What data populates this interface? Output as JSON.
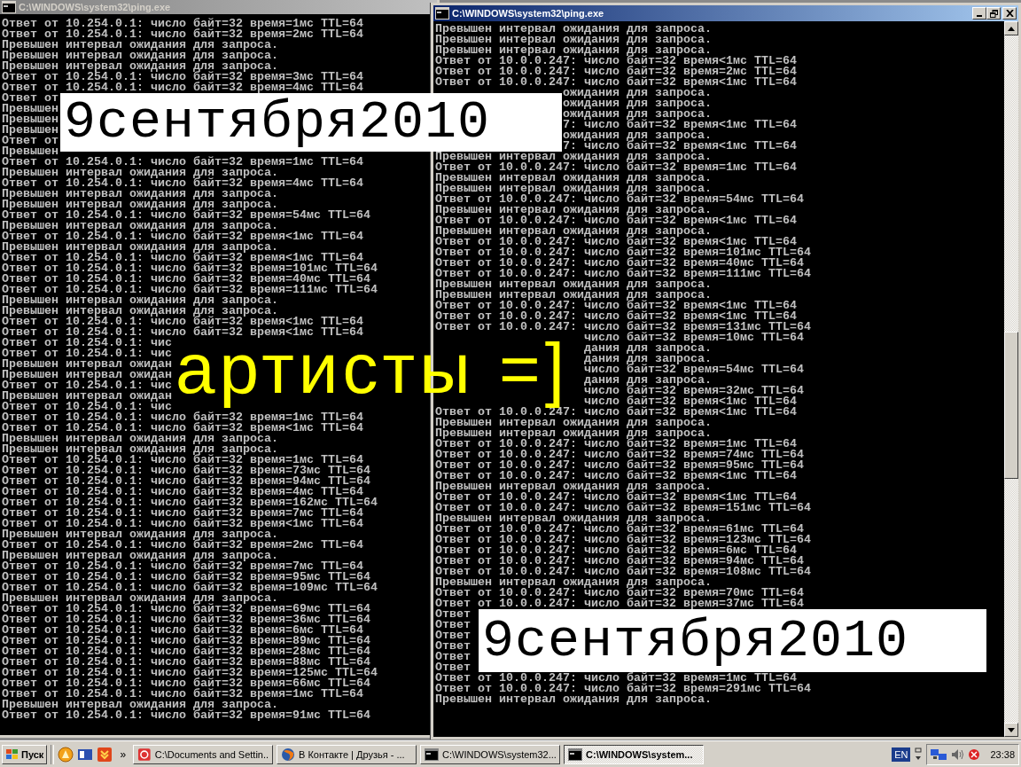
{
  "back_window": {
    "title": "C:\\WINDOWS\\system32\\ping.exe",
    "active": false,
    "lines": [
      "Ответ от 10.254.0.1: число байт=32 время=1мс TTL=64",
      "Ответ от 10.254.0.1: число байт=32 время=2мс TTL=64",
      "Превышен интервал ожидания для запроса.",
      "Превышен интервал ожидания для запроса.",
      "Превышен интервал ожидания для запроса.",
      "Ответ от 10.254.0.1: число байт=32 время=3мс TTL=64",
      "Ответ от 10.254.0.1: число байт=32 время=4мс TTL=64",
      "Ответ от",
      "Превышен",
      "Превышен",
      "Превышен",
      "Ответ от",
      "Превышен",
      "Ответ от 10.254.0.1: число байт=32 время=1мс TTL=64",
      "Превышен интервал ожидания для запроса.",
      "Ответ от 10.254.0.1: число байт=32 время=4мс TTL=64",
      "Превышен интервал ожидания для запроса.",
      "Превышен интервал ожидания для запроса.",
      "Ответ от 10.254.0.1: число байт=32 время=54мс TTL=64",
      "Превышен интервал ожидания для запроса.",
      "Ответ от 10.254.0.1: число байт=32 время<1мс TTL=64",
      "Превышен интервал ожидания для запроса.",
      "Ответ от 10.254.0.1: число байт=32 время<1мс TTL=64",
      "Ответ от 10.254.0.1: число байт=32 время=101мс TTL=64",
      "Ответ от 10.254.0.1: число байт=32 время=40мс TTL=64",
      "Ответ от 10.254.0.1: число байт=32 время=111мс TTL=64",
      "Превышен интервал ожидания для запроса.",
      "Превышен интервал ожидания для запроса.",
      "Ответ от 10.254.0.1: число байт=32 время<1мс TTL=64",
      "Ответ от 10.254.0.1: число байт=32 время<1мс TTL=64",
      "Ответ от 10.254.0.1: чис",
      "Ответ от 10.254.0.1: чис",
      "Превышен интервал ожидан",
      "Превышен интервал ожидан",
      "Ответ от 10.254.0.1: чис",
      "Превышен интервал ожидан",
      "Ответ от 10.254.0.1: чис",
      "Ответ от 10.254.0.1: число байт=32 время=1мс TTL=64",
      "Ответ от 10.254.0.1: число байт=32 время<1мс TTL=64",
      "Превышен интервал ожидания для запроса.",
      "Превышен интервал ожидания для запроса.",
      "Ответ от 10.254.0.1: число байт=32 время=1мс TTL=64",
      "Ответ от 10.254.0.1: число байт=32 время=73мс TTL=64",
      "Ответ от 10.254.0.1: число байт=32 время=94мс TTL=64",
      "Ответ от 10.254.0.1: число байт=32 время=4мс TTL=64",
      "Ответ от 10.254.0.1: число байт=32 время=162мс TTL=64",
      "Ответ от 10.254.0.1: число байт=32 время=7мс TTL=64",
      "Ответ от 10.254.0.1: число байт=32 время<1мс TTL=64",
      "Превышен интервал ожидания для запроса.",
      "Ответ от 10.254.0.1: число байт=32 время=2мс TTL=64",
      "Превышен интервал ожидания для запроса.",
      "Ответ от 10.254.0.1: число байт=32 время=7мс TTL=64",
      "Ответ от 10.254.0.1: число байт=32 время=95мс TTL=64",
      "Ответ от 10.254.0.1: число байт=32 время=109мс TTL=64",
      "Превышен интервал ожидания для запроса.",
      "Ответ от 10.254.0.1: число байт=32 время=69мс TTL=64",
      "Ответ от 10.254.0.1: число байт=32 время=36мс TTL=64",
      "Ответ от 10.254.0.1: число байт=32 время=6мс TTL=64",
      "Ответ от 10.254.0.1: число байт=32 время=89мс TTL=64",
      "Ответ от 10.254.0.1: число байт=32 время=28мс TTL=64",
      "Ответ от 10.254.0.1: число байт=32 время=88мс TTL=64",
      "Ответ от 10.254.0.1: число байт=32 время=125мс TTL=64",
      "Ответ от 10.254.0.1: число байт=32 время=66мс TTL=64",
      "Ответ от 10.254.0.1: число байт=32 время=1мс TTL=64",
      "Превышен интервал ожидания для запроса.",
      "Ответ от 10.254.0.1: число байт=32 время=91мс TTL=64"
    ]
  },
  "front_window": {
    "title": "C:\\WINDOWS\\system32\\ping.exe",
    "active": true,
    "lines": [
      {
        "text": "Превышен интервал ожидания для запроса.",
        "under_label": false,
        "under_caption": false
      },
      {
        "text": "Превышен интервал ожидания для запроса.",
        "under_label": false,
        "under_caption": false
      },
      {
        "text": "Превышен интервал ожидания для запроса.",
        "under_label": false,
        "under_caption": false
      },
      {
        "text": "Ответ от 10.0.0.247: число байт=32 время<1мс TTL=64",
        "under_label": false,
        "under_caption": false
      },
      {
        "text": "Ответ от 10.0.0.247: число байт=32 время=2мс TTL=64",
        "under_label": false,
        "under_caption": false
      },
      {
        "text": "Ответ от 10.0.0.247: число байт=32 время<1мс TTL=64",
        "under_label": false,
        "under_caption": false
      },
      {
        "text": "ожидания для запроса.",
        "under_label": true,
        "under_caption": false
      },
      {
        "text": "ожидания для запроса.",
        "under_label": true,
        "under_caption": false
      },
      {
        "text": "ожидания для запроса.",
        "under_label": true,
        "under_caption": false
      },
      {
        "text": "7: число байт=32 время<1мс TTL=64",
        "under_label": true,
        "under_caption": false
      },
      {
        "text": "ожидания для запроса.",
        "under_label": true,
        "under_caption": false
      },
      {
        "text": "7: число байт=32 время<1мс TTL=64",
        "under_label": true,
        "under_caption": false
      },
      {
        "text": "Превышен интервал ожидания для запроса.",
        "under_label": false,
        "under_caption": false
      },
      {
        "text": "Ответ от 10.0.0.247: число байт=32 время=1мс TTL=64",
        "under_label": false,
        "under_caption": false
      },
      {
        "text": "Превышен интервал ожидания для запроса.",
        "under_label": false,
        "under_caption": false
      },
      {
        "text": "Превышен интервал ожидания для запроса.",
        "under_label": false,
        "under_caption": false
      },
      {
        "text": "Ответ от 10.0.0.247: число байт=32 время=54мс TTL=64",
        "under_label": false,
        "under_caption": false
      },
      {
        "text": "Превышен интервал ожидания для запроса.",
        "under_label": false,
        "under_caption": false
      },
      {
        "text": "Ответ от 10.0.0.247: число байт=32 время<1мс TTL=64",
        "under_label": false,
        "under_caption": false
      },
      {
        "text": "Превышен интервал ожидания для запроса.",
        "under_label": false,
        "under_caption": false
      },
      {
        "text": "Ответ от 10.0.0.247: число байт=32 время<1мс TTL=64",
        "under_label": false,
        "under_caption": false
      },
      {
        "text": "Ответ от 10.0.0.247: число байт=32 время=101мс TTL=64",
        "under_label": false,
        "under_caption": false
      },
      {
        "text": "Ответ от 10.0.0.247: число байт=32 время=40мс TTL=64",
        "under_label": false,
        "under_caption": false
      },
      {
        "text": "Ответ от 10.0.0.247: число байт=32 время=111мс TTL=64",
        "under_label": false,
        "under_caption": false
      },
      {
        "text": "Превышен интервал ожидания для запроса.",
        "under_label": false,
        "under_caption": false
      },
      {
        "text": "Превышен интервал ожидания для запроса.",
        "under_label": false,
        "under_caption": false
      },
      {
        "text": "Ответ от 10.0.0.247: число байт=32 время<1мс TTL=64",
        "under_label": false,
        "under_caption": false
      },
      {
        "text": "Ответ от 10.0.0.247: число байт=32 время<1мс TTL=64",
        "under_label": false,
        "under_caption": false
      },
      {
        "text": "Ответ от 10.0.0.247: число байт=32 время=131мс TTL=64",
        "under_label": false,
        "under_caption": false
      },
      {
        "text": "число байт=32 время=10мс TTL=64",
        "under_label": false,
        "under_caption": true
      },
      {
        "text": "дания для запроса.",
        "under_label": false,
        "under_caption": true
      },
      {
        "text": "дания для запроса.",
        "under_label": false,
        "under_caption": true
      },
      {
        "text": "число байт=32 время=54мс TTL=64",
        "under_label": false,
        "under_caption": true
      },
      {
        "text": "дания для запроса.",
        "under_label": false,
        "under_caption": true
      },
      {
        "text": "число байт=32 время=32мс TTL=64",
        "under_label": false,
        "under_caption": true
      },
      {
        "text": "число байт=32 время<1мс TTL=64",
        "under_label": false,
        "under_caption": true
      },
      {
        "text": "Ответ от 10.0.0.247: число байт=32 время<1мс TTL=64",
        "under_label": false,
        "under_caption": false
      },
      {
        "text": "Превышен интервал ожидания для запроса.",
        "under_label": false,
        "under_caption": false
      },
      {
        "text": "Превышен интервал ожидания для запроса.",
        "under_label": false,
        "under_caption": false
      },
      {
        "text": "Ответ от 10.0.0.247: число байт=32 время=1мс TTL=64",
        "under_label": false,
        "under_caption": false
      },
      {
        "text": "Ответ от 10.0.0.247: число байт=32 время=74мс TTL=64",
        "under_label": false,
        "under_caption": false
      },
      {
        "text": "Ответ от 10.0.0.247: число байт=32 время=95мс TTL=64",
        "under_label": false,
        "under_caption": false
      },
      {
        "text": "Ответ от 10.0.0.247: число байт=32 время<1мс TTL=64",
        "under_label": false,
        "under_caption": false
      },
      {
        "text": "Превышен интервал ожидания для запроса.",
        "under_label": false,
        "under_caption": false
      },
      {
        "text": "Ответ от 10.0.0.247: число байт=32 время<1мс TTL=64",
        "under_label": false,
        "under_caption": false
      },
      {
        "text": "Ответ от 10.0.0.247: число байт=32 время=151мс TTL=64",
        "under_label": false,
        "under_caption": false
      },
      {
        "text": "Превышен интервал ожидания для запроса.",
        "under_label": false,
        "under_caption": false
      },
      {
        "text": "Ответ от 10.0.0.247: число байт=32 время=61мс TTL=64",
        "under_label": false,
        "under_caption": false
      },
      {
        "text": "Ответ от 10.0.0.247: число байт=32 время=123мс TTL=64",
        "under_label": false,
        "under_caption": false
      },
      {
        "text": "Ответ от 10.0.0.247: число байт=32 время=6мс TTL=64",
        "under_label": false,
        "under_caption": false
      },
      {
        "text": "Ответ от 10.0.0.247: число байт=32 время=94мс TTL=64",
        "under_label": false,
        "under_caption": false
      },
      {
        "text": "Ответ от 10.0.0.247: число байт=32 время=108мс TTL=64",
        "under_label": false,
        "under_caption": false
      },
      {
        "text": "Превышен интервал ожидания для запроса.",
        "under_label": false,
        "under_caption": false
      },
      {
        "text": "Ответ от 10.0.0.247: число байт=32 время=70мс TTL=64",
        "under_label": false,
        "under_caption": false
      },
      {
        "text": "Ответ от 10.0.0.247: число байт=32 время=37мс TTL=64",
        "under_label": false,
        "under_caption": false
      },
      {
        "text": "Ответ",
        "under_label": false,
        "under_caption": false
      },
      {
        "text": "Ответ",
        "under_label": false,
        "under_caption": false
      },
      {
        "text": "Ответ",
        "under_label": false,
        "under_caption": false
      },
      {
        "text": "Ответ",
        "under_label": false,
        "under_caption": false
      },
      {
        "text": "Ответ",
        "under_label": false,
        "under_caption": false
      },
      {
        "text": "Ответ",
        "under_label": false,
        "under_caption": false
      },
      {
        "text": "Ответ от 10.0.0.247: число байт=32 время=1мс TTL=64",
        "under_label": false,
        "under_caption": false
      },
      {
        "text": "Ответ от 10.0.0.247: число байт=32 время=291мс TTL=64",
        "under_label": false,
        "under_caption": false
      },
      {
        "text": "Превышен интервал ожидания для запроса.",
        "under_label": false,
        "under_caption": false
      }
    ]
  },
  "stamp_top": "9сентября2010",
  "caption": "артисты =]",
  "stamp_bottom": "9сентября2010",
  "taskbar": {
    "start": "Пуск",
    "more": "»",
    "tasks": [
      {
        "label": "C:\\Documents and Settin...",
        "kind": "folder",
        "selected": false
      },
      {
        "label": "В Контакте | Друзья - ...",
        "kind": "browser",
        "selected": false
      },
      {
        "label": "C:\\WINDOWS\\system32...",
        "kind": "console",
        "selected": false
      },
      {
        "label": "C:\\WINDOWS\\system...",
        "kind": "console",
        "selected": true
      }
    ],
    "language": "EN",
    "clock": "23:38"
  }
}
